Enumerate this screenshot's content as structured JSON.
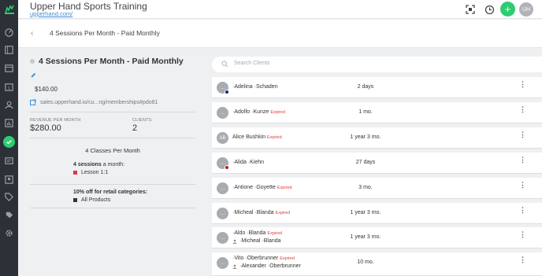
{
  "header": {
    "title": "Upper Hand Sports Training",
    "url": "upperhand.com/",
    "add_symbol": "+",
    "avatar_initials": "UH"
  },
  "subheader": {
    "back_symbol": "‹",
    "title": "4 Sessions Per Month - Paid Monthly"
  },
  "membership": {
    "title": "4 Sessions Per Month - Paid Monthly",
    "price": "$140.00",
    "link": "sales.upperhand.io/cu...ng/memberships#pdo81",
    "revenue_label": "REVENUE PER MONTH",
    "revenue_value": "$280.00",
    "clients_label": "CLIENTS",
    "clients_value": "2",
    "classes_text": "4 Classes Per Month",
    "benefit1_bold": "4 sessions",
    "benefit1_rest": " a month:",
    "benefit1_item": "Lesson 1:1",
    "benefit2_title": "10% off for retail categories:",
    "benefit2_item": "All Products"
  },
  "search": {
    "placeholder": "Search Clients"
  },
  "clients": [
    {
      "initials": "...",
      "name": "·Adelina ·Schaden",
      "expired": "",
      "sub": "",
      "duration": "2 days",
      "badge": "#1a237e"
    },
    {
      "initials": "...",
      "name": "·Adolfo ·Kunze",
      "expired": "Expired",
      "sub": "",
      "duration": "1 mo.",
      "badge": ""
    },
    {
      "initials": "AB",
      "name": "Alice Bushkin",
      "expired": "Expired",
      "sub": "",
      "duration": "1 year 3 mo.",
      "badge": ""
    },
    {
      "initials": "...",
      "name": "·Alida ·Kiehn",
      "expired": "",
      "sub": "",
      "duration": "27 days",
      "badge": "#b71c1c"
    },
    {
      "initials": "...",
      "name": "·Antione ·Goyette",
      "expired": "Expired",
      "sub": "",
      "duration": "3 mo.",
      "badge": ""
    },
    {
      "initials": "...",
      "name": "·Micheal ·Blanda",
      "expired": "Expired",
      "sub": "",
      "duration": "1 year 3 mo.",
      "badge": ""
    },
    {
      "initials": "...",
      "name": "·Aldo ·Blanda",
      "expired": "Expired",
      "sub": "·Micheal ·Blanda",
      "duration": "1 year 3 mo.",
      "badge": ""
    },
    {
      "initials": "...",
      "name": "·Vito ·Oberbrunner",
      "expired": "Expired",
      "sub": "·Alexander ·Oberbrunner",
      "duration": "10 mo.",
      "badge": ""
    }
  ],
  "menu_symbol": "⋮",
  "colors": {
    "accent": "#2ecc71",
    "expired": "#e0393e",
    "link": "#3a8fd9",
    "rail": "#2b3137"
  }
}
